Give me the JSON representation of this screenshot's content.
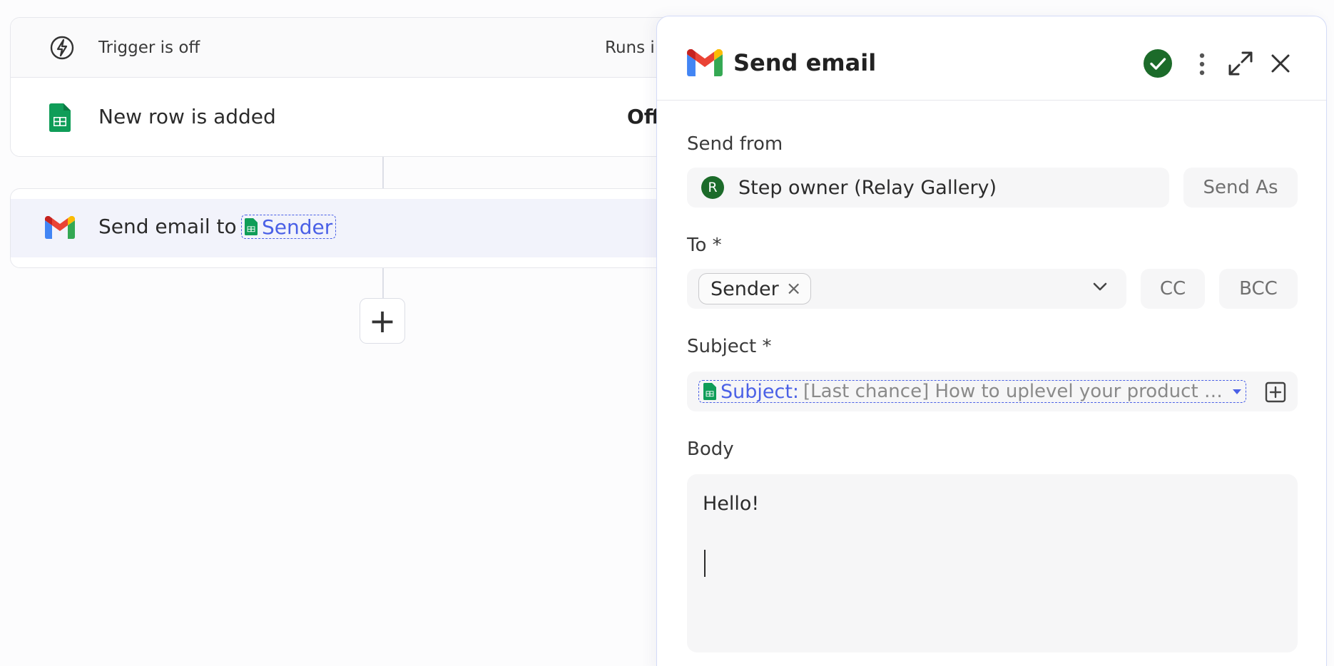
{
  "workflow": {
    "trigger_header": {
      "status_label": "Trigger is off",
      "runs_label": "Runs i"
    },
    "trigger_step": {
      "label": "New row is added",
      "state": "Off"
    },
    "action_step": {
      "label": "Send email to",
      "variable_label": "Sender"
    },
    "add_step_symbol": "+"
  },
  "panel": {
    "title": "Send email",
    "send_from": {
      "label": "Send from",
      "avatar_letter": "R",
      "value": "Step owner (Relay Gallery)",
      "send_as_label": "Send As"
    },
    "to": {
      "label": "To *",
      "chip_label": "Sender",
      "chip_remove": "×",
      "cc_label": "CC",
      "bcc_label": "BCC"
    },
    "subject": {
      "label": "Subject *",
      "token_key": "Subject:",
      "token_value": "[Last chance] How to uplevel your product d..."
    },
    "body": {
      "label": "Body",
      "text": "Hello!"
    }
  },
  "colors": {
    "accent": "#4a60e6",
    "success": "#1c6b2a",
    "sheets_green": "#0f9d58",
    "gmail_red": "#ea4335"
  }
}
